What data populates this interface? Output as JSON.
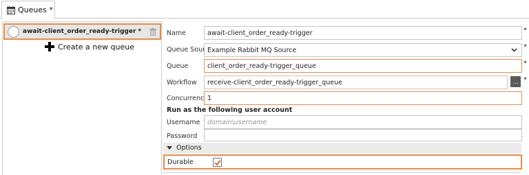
{
  "tab": {
    "title": "Queues *",
    "icon": "calendar-icon"
  },
  "left_panel": {
    "queue_item": {
      "name": "await-client_order_ready-trigger *"
    },
    "create_label": "Create a new queue"
  },
  "form": {
    "name": {
      "label": "Name",
      "value": "await-client_order_ready-trigger",
      "required": "*"
    },
    "queue_source": {
      "label": "Queue Source",
      "value": "Example Rabbit MQ Source",
      "required": "*"
    },
    "queue": {
      "label": "Queue",
      "value": "client_order_ready-trigger_queue",
      "required": "*"
    },
    "workflow": {
      "label": "Workflow",
      "value": "receive-client_order_ready-trigger_queue",
      "browse": "...",
      "required": "*"
    },
    "concurrency": {
      "label": "Concurrency",
      "value": "1"
    },
    "user_account_title": "Run as the following user account",
    "username": {
      "label": "Username",
      "placeholder": "domain\\username"
    },
    "password": {
      "label": "Password",
      "value": ""
    },
    "options_label": "Options",
    "durable": {
      "label": "Durable",
      "checked": true
    }
  },
  "colors": {
    "highlight": "#f0883e",
    "selected_bg": "#e6e6e6"
  }
}
